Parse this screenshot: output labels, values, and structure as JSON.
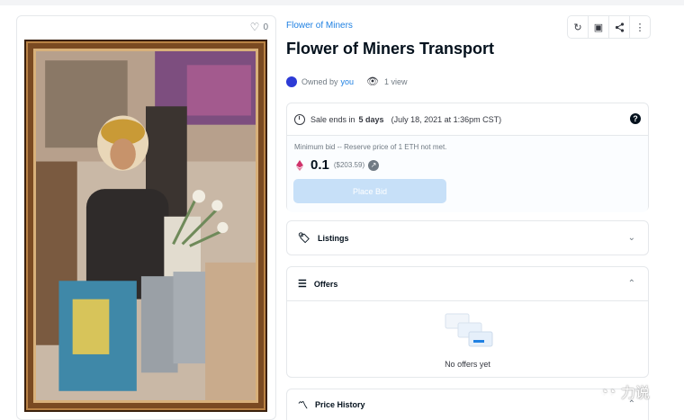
{
  "asset": {
    "favorites": "0"
  },
  "header": {
    "collection": "Flower of Miners",
    "title": "Flower of Miners Transport",
    "actions": [
      "refresh-icon",
      "gift-icon",
      "share-icon",
      "more-icon"
    ]
  },
  "owner": {
    "owned_by": "Owned by",
    "owner_name": "you",
    "views": "1 view"
  },
  "sale": {
    "ends_prefix": "Sale ends in",
    "ends_in": "5 days",
    "end_date": "(July 18, 2021 at 1:36pm CST)",
    "help": "?",
    "min_bid": "Minimum bid -- Reserve price of 1 ETH not met.",
    "price": "0.1",
    "usd": "($203.59)",
    "place_bid_label": "Place Bid"
  },
  "listings": {
    "label": "Listings"
  },
  "offers": {
    "label": "Offers",
    "empty": "No offers yet"
  },
  "price_history": {
    "label": "Price History"
  },
  "watermark": {
    "text": "力说"
  },
  "colors": {
    "accent": "#2081e2",
    "button_disabled": "#c7e0f8",
    "eth": "#d0336b"
  }
}
